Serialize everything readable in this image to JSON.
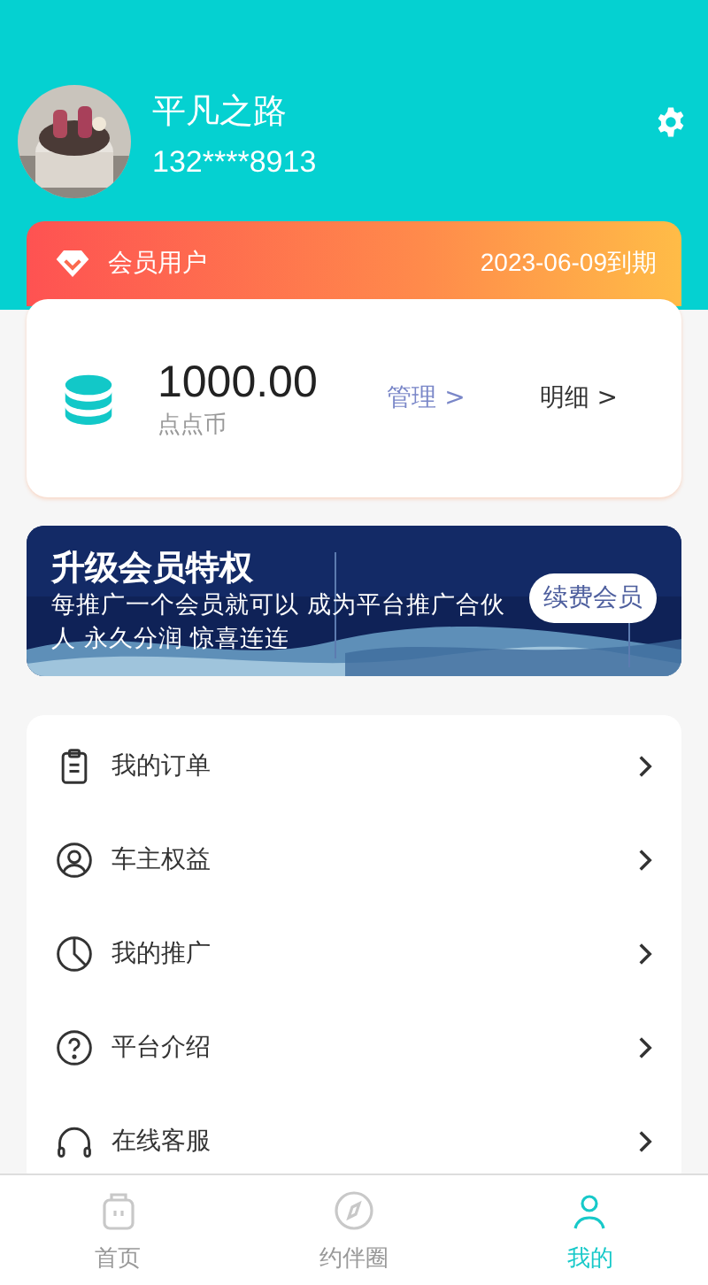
{
  "profile": {
    "name": "平凡之路",
    "phone": "132****8913"
  },
  "membership": {
    "label": "会员用户",
    "expiry": "2023-06-09到期"
  },
  "wallet": {
    "amount": "1000.00",
    "unit": "点点币",
    "links": [
      "管理 >",
      "明细 >"
    ]
  },
  "banner": {
    "title": "升级会员特权",
    "text": "每推广一个会员就可以 成为平台推广合伙人 永久分润 惊喜连连",
    "button": "续费会员"
  },
  "menu": [
    {
      "label": "我的订单"
    },
    {
      "label": "车主权益"
    },
    {
      "label": "我的推广"
    },
    {
      "label": "平台介绍"
    },
    {
      "label": "在线客服"
    }
  ],
  "tabs": [
    {
      "label": "首页",
      "selected": false
    },
    {
      "label": "约伴圈",
      "selected": false
    },
    {
      "label": "我的",
      "selected": true
    }
  ]
}
